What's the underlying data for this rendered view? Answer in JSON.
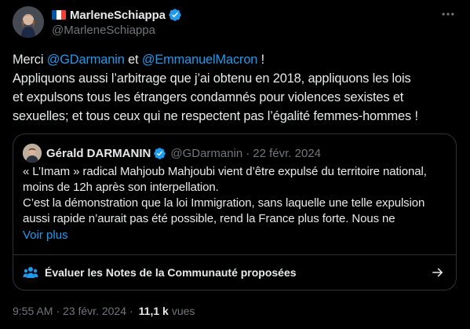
{
  "author": {
    "display_name": "MarleneSchiappa",
    "handle": "@MarleneSchiappa",
    "flag_colors": [
      "#0055a4",
      "#ffffff",
      "#ef4135"
    ],
    "verified_color": "#1d9bf0"
  },
  "tweet": {
    "lines": [
      {
        "parts": [
          {
            "text": "Merci ",
            "type": "text"
          },
          {
            "text": "@GDarmanin",
            "type": "mention"
          },
          {
            "text": " et ",
            "type": "text"
          },
          {
            "text": "@EmmanuelMacron",
            "type": "mention"
          },
          {
            "text": " !",
            "type": "text"
          }
        ]
      },
      {
        "parts": [
          {
            "text": "Appliquons aussi l’arbitrage que j’ai obtenu en 2018, appliquons les lois",
            "type": "text"
          }
        ]
      },
      {
        "parts": [
          {
            "text": "et expulsons tous les étrangers condamnés pour violences sexistes et",
            "type": "text"
          }
        ]
      },
      {
        "parts": [
          {
            "text": "sexuelles; et tous ceux qui ne respectent pas l’égalité femmes-hommes !",
            "type": "text"
          }
        ]
      }
    ]
  },
  "quote": {
    "display_name": "Gérald DARMANIN",
    "handle": "@GDarmanin",
    "dot": "·",
    "date": "22 févr. 2024",
    "lines": [
      "« L’Imam » radical Mahjoub Mahjoubi vient d’être expulsé du territoire national,",
      "moins de 12h après son interpellation.",
      "C’est la démonstration que la loi Immigration, sans laquelle une telle expulsion",
      "aussi rapide n’aurait pas été possible, rend la France plus forte. Nous ne"
    ],
    "show_more": "Voir plus",
    "community_notes_label": "Évaluer les Notes de la Communauté proposées"
  },
  "footer": {
    "time": "9:55 AM",
    "separator": "·",
    "date": "23 févr. 2024",
    "views_count": "11,1 k",
    "views_label": "vues"
  },
  "colors": {
    "background": "#000000",
    "text": "#e7e9ea",
    "secondary": "#71767b",
    "accent": "#1d9bf0",
    "border": "#2f3336"
  },
  "icons": {
    "more": "more-horizontal-icon",
    "verified": "verified-badge-icon",
    "community": "community-people-icon",
    "arrow": "arrow-right-icon"
  }
}
